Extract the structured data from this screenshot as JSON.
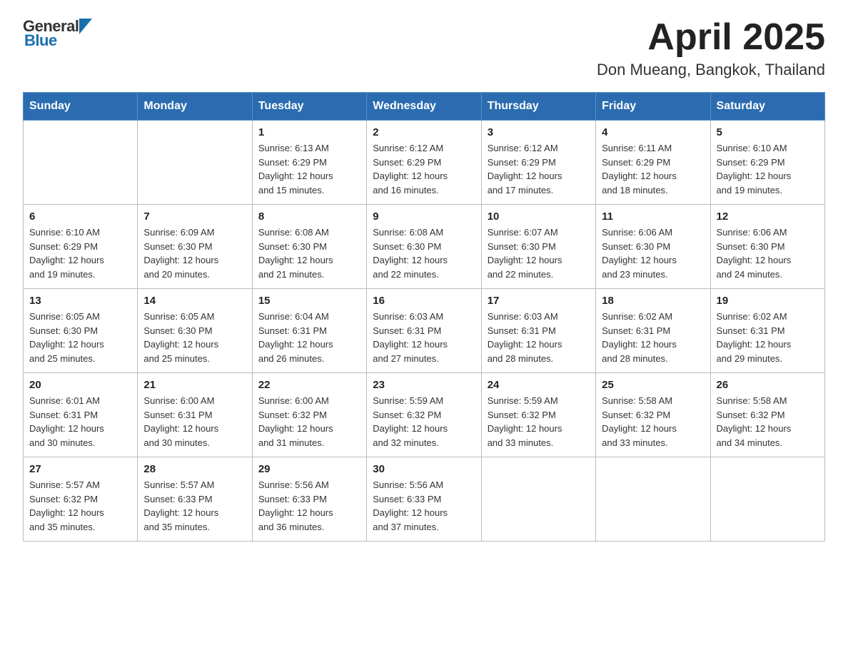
{
  "header": {
    "logo": {
      "general": "General",
      "blue": "Blue"
    },
    "title": "April 2025",
    "subtitle": "Don Mueang, Bangkok, Thailand"
  },
  "calendar": {
    "weekdays": [
      "Sunday",
      "Monday",
      "Tuesday",
      "Wednesday",
      "Thursday",
      "Friday",
      "Saturday"
    ],
    "weeks": [
      [
        {
          "day": "",
          "info": ""
        },
        {
          "day": "",
          "info": ""
        },
        {
          "day": "1",
          "info": "Sunrise: 6:13 AM\nSunset: 6:29 PM\nDaylight: 12 hours\nand 15 minutes."
        },
        {
          "day": "2",
          "info": "Sunrise: 6:12 AM\nSunset: 6:29 PM\nDaylight: 12 hours\nand 16 minutes."
        },
        {
          "day": "3",
          "info": "Sunrise: 6:12 AM\nSunset: 6:29 PM\nDaylight: 12 hours\nand 17 minutes."
        },
        {
          "day": "4",
          "info": "Sunrise: 6:11 AM\nSunset: 6:29 PM\nDaylight: 12 hours\nand 18 minutes."
        },
        {
          "day": "5",
          "info": "Sunrise: 6:10 AM\nSunset: 6:29 PM\nDaylight: 12 hours\nand 19 minutes."
        }
      ],
      [
        {
          "day": "6",
          "info": "Sunrise: 6:10 AM\nSunset: 6:29 PM\nDaylight: 12 hours\nand 19 minutes."
        },
        {
          "day": "7",
          "info": "Sunrise: 6:09 AM\nSunset: 6:30 PM\nDaylight: 12 hours\nand 20 minutes."
        },
        {
          "day": "8",
          "info": "Sunrise: 6:08 AM\nSunset: 6:30 PM\nDaylight: 12 hours\nand 21 minutes."
        },
        {
          "day": "9",
          "info": "Sunrise: 6:08 AM\nSunset: 6:30 PM\nDaylight: 12 hours\nand 22 minutes."
        },
        {
          "day": "10",
          "info": "Sunrise: 6:07 AM\nSunset: 6:30 PM\nDaylight: 12 hours\nand 22 minutes."
        },
        {
          "day": "11",
          "info": "Sunrise: 6:06 AM\nSunset: 6:30 PM\nDaylight: 12 hours\nand 23 minutes."
        },
        {
          "day": "12",
          "info": "Sunrise: 6:06 AM\nSunset: 6:30 PM\nDaylight: 12 hours\nand 24 minutes."
        }
      ],
      [
        {
          "day": "13",
          "info": "Sunrise: 6:05 AM\nSunset: 6:30 PM\nDaylight: 12 hours\nand 25 minutes."
        },
        {
          "day": "14",
          "info": "Sunrise: 6:05 AM\nSunset: 6:30 PM\nDaylight: 12 hours\nand 25 minutes."
        },
        {
          "day": "15",
          "info": "Sunrise: 6:04 AM\nSunset: 6:31 PM\nDaylight: 12 hours\nand 26 minutes."
        },
        {
          "day": "16",
          "info": "Sunrise: 6:03 AM\nSunset: 6:31 PM\nDaylight: 12 hours\nand 27 minutes."
        },
        {
          "day": "17",
          "info": "Sunrise: 6:03 AM\nSunset: 6:31 PM\nDaylight: 12 hours\nand 28 minutes."
        },
        {
          "day": "18",
          "info": "Sunrise: 6:02 AM\nSunset: 6:31 PM\nDaylight: 12 hours\nand 28 minutes."
        },
        {
          "day": "19",
          "info": "Sunrise: 6:02 AM\nSunset: 6:31 PM\nDaylight: 12 hours\nand 29 minutes."
        }
      ],
      [
        {
          "day": "20",
          "info": "Sunrise: 6:01 AM\nSunset: 6:31 PM\nDaylight: 12 hours\nand 30 minutes."
        },
        {
          "day": "21",
          "info": "Sunrise: 6:00 AM\nSunset: 6:31 PM\nDaylight: 12 hours\nand 30 minutes."
        },
        {
          "day": "22",
          "info": "Sunrise: 6:00 AM\nSunset: 6:32 PM\nDaylight: 12 hours\nand 31 minutes."
        },
        {
          "day": "23",
          "info": "Sunrise: 5:59 AM\nSunset: 6:32 PM\nDaylight: 12 hours\nand 32 minutes."
        },
        {
          "day": "24",
          "info": "Sunrise: 5:59 AM\nSunset: 6:32 PM\nDaylight: 12 hours\nand 33 minutes."
        },
        {
          "day": "25",
          "info": "Sunrise: 5:58 AM\nSunset: 6:32 PM\nDaylight: 12 hours\nand 33 minutes."
        },
        {
          "day": "26",
          "info": "Sunrise: 5:58 AM\nSunset: 6:32 PM\nDaylight: 12 hours\nand 34 minutes."
        }
      ],
      [
        {
          "day": "27",
          "info": "Sunrise: 5:57 AM\nSunset: 6:32 PM\nDaylight: 12 hours\nand 35 minutes."
        },
        {
          "day": "28",
          "info": "Sunrise: 5:57 AM\nSunset: 6:33 PM\nDaylight: 12 hours\nand 35 minutes."
        },
        {
          "day": "29",
          "info": "Sunrise: 5:56 AM\nSunset: 6:33 PM\nDaylight: 12 hours\nand 36 minutes."
        },
        {
          "day": "30",
          "info": "Sunrise: 5:56 AM\nSunset: 6:33 PM\nDaylight: 12 hours\nand 37 minutes."
        },
        {
          "day": "",
          "info": ""
        },
        {
          "day": "",
          "info": ""
        },
        {
          "day": "",
          "info": ""
        }
      ]
    ]
  }
}
